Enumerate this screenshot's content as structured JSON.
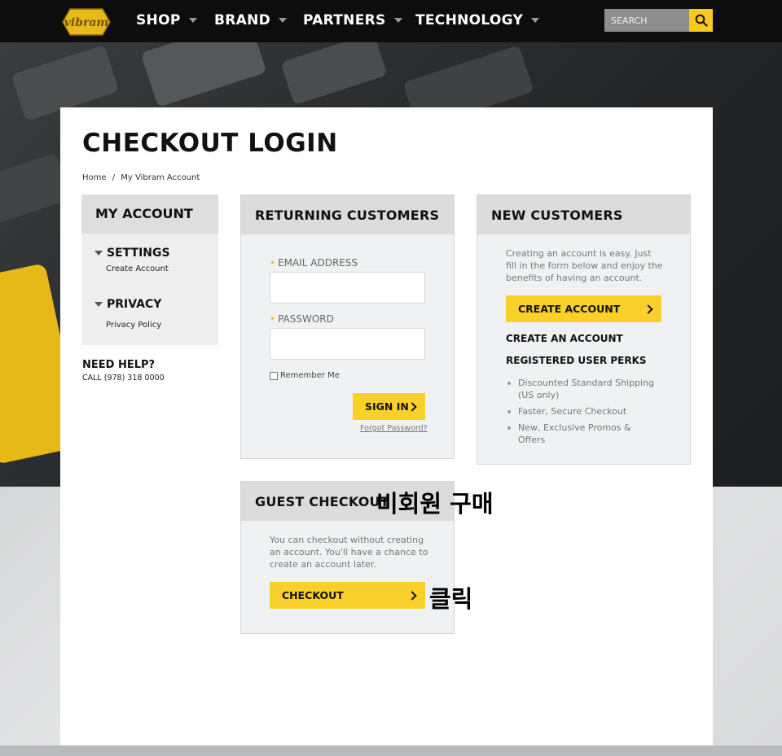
{
  "nav": {
    "logo_text": "vibram",
    "items": [
      {
        "label": "SHOP"
      },
      {
        "label": "BRAND"
      },
      {
        "label": "PARTNERS"
      },
      {
        "label": "TECHNOLOGY"
      }
    ],
    "search_placeholder": "SEARCH"
  },
  "page": {
    "title": "CHECKOUT LOGIN",
    "breadcrumb": [
      "Home",
      "/",
      "My Vibram Account"
    ]
  },
  "sidebar": {
    "heading": "MY ACCOUNT",
    "sections": [
      {
        "label": "SETTINGS",
        "link": "Create Account"
      },
      {
        "label": "PRIVACY",
        "link": "Privacy Policy"
      }
    ],
    "help_title": "NEED HELP?",
    "help_phone": "CALL (978) 318 0000"
  },
  "returning": {
    "heading": "RETURNING CUSTOMERS",
    "email_label": "EMAIL ADDRESS",
    "email_value": "",
    "password_label": "PASSWORD",
    "password_value": "",
    "remember_label": "Remember Me",
    "signin_label": "SIGN IN",
    "forgot_label": "Forgot Password?"
  },
  "new_customers": {
    "heading": "NEW CUSTOMERS",
    "intro": "Creating an account is easy. Just fill in the form below and enjoy the benefits of having an account.",
    "create_button": "CREATE ACCOUNT",
    "create_heading": "CREATE AN ACCOUNT",
    "perks_heading": "REGISTERED USER PERKS",
    "perks": [
      "Discounted Standard Shipping (US only)",
      "Faster, Secure Checkout",
      "New, Exclusive Promos & Offers"
    ]
  },
  "guest": {
    "heading": "GUEST CHECKOUT",
    "intro": "You can checkout without creating an account. You'll have a chance to create an account later.",
    "checkout_button": "CHECKOUT"
  },
  "annotations": {
    "guest_note": "비회원 구매",
    "click_note": "클릭"
  },
  "colors": {
    "accent": "#fad12a",
    "nav_bg": "#0d0d0d",
    "box_head": "#dcdcdc"
  }
}
